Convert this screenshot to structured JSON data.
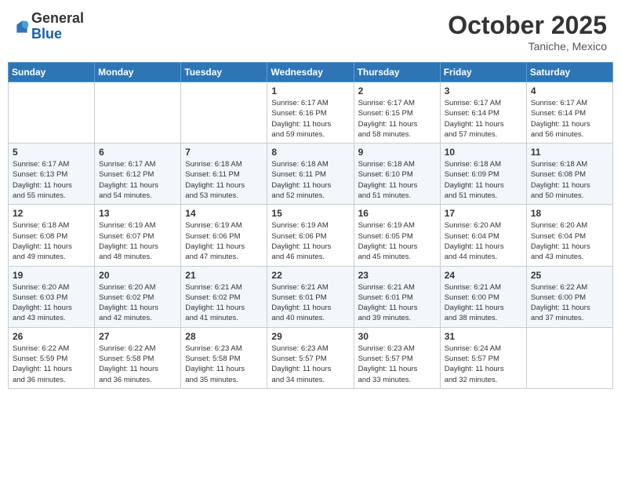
{
  "header": {
    "logo": {
      "general": "General",
      "blue": "Blue"
    },
    "title": "October 2025",
    "location": "Taniche, Mexico"
  },
  "weekdays": [
    "Sunday",
    "Monday",
    "Tuesday",
    "Wednesday",
    "Thursday",
    "Friday",
    "Saturday"
  ],
  "weeks": [
    [
      {
        "day": "",
        "info": ""
      },
      {
        "day": "",
        "info": ""
      },
      {
        "day": "",
        "info": ""
      },
      {
        "day": "1",
        "info": "Sunrise: 6:17 AM\nSunset: 6:16 PM\nDaylight: 11 hours\nand 59 minutes."
      },
      {
        "day": "2",
        "info": "Sunrise: 6:17 AM\nSunset: 6:15 PM\nDaylight: 11 hours\nand 58 minutes."
      },
      {
        "day": "3",
        "info": "Sunrise: 6:17 AM\nSunset: 6:14 PM\nDaylight: 11 hours\nand 57 minutes."
      },
      {
        "day": "4",
        "info": "Sunrise: 6:17 AM\nSunset: 6:14 PM\nDaylight: 11 hours\nand 56 minutes."
      }
    ],
    [
      {
        "day": "5",
        "info": "Sunrise: 6:17 AM\nSunset: 6:13 PM\nDaylight: 11 hours\nand 55 minutes."
      },
      {
        "day": "6",
        "info": "Sunrise: 6:17 AM\nSunset: 6:12 PM\nDaylight: 11 hours\nand 54 minutes."
      },
      {
        "day": "7",
        "info": "Sunrise: 6:18 AM\nSunset: 6:11 PM\nDaylight: 11 hours\nand 53 minutes."
      },
      {
        "day": "8",
        "info": "Sunrise: 6:18 AM\nSunset: 6:11 PM\nDaylight: 11 hours\nand 52 minutes."
      },
      {
        "day": "9",
        "info": "Sunrise: 6:18 AM\nSunset: 6:10 PM\nDaylight: 11 hours\nand 51 minutes."
      },
      {
        "day": "10",
        "info": "Sunrise: 6:18 AM\nSunset: 6:09 PM\nDaylight: 11 hours\nand 51 minutes."
      },
      {
        "day": "11",
        "info": "Sunrise: 6:18 AM\nSunset: 6:08 PM\nDaylight: 11 hours\nand 50 minutes."
      }
    ],
    [
      {
        "day": "12",
        "info": "Sunrise: 6:18 AM\nSunset: 6:08 PM\nDaylight: 11 hours\nand 49 minutes."
      },
      {
        "day": "13",
        "info": "Sunrise: 6:19 AM\nSunset: 6:07 PM\nDaylight: 11 hours\nand 48 minutes."
      },
      {
        "day": "14",
        "info": "Sunrise: 6:19 AM\nSunset: 6:06 PM\nDaylight: 11 hours\nand 47 minutes."
      },
      {
        "day": "15",
        "info": "Sunrise: 6:19 AM\nSunset: 6:06 PM\nDaylight: 11 hours\nand 46 minutes."
      },
      {
        "day": "16",
        "info": "Sunrise: 6:19 AM\nSunset: 6:05 PM\nDaylight: 11 hours\nand 45 minutes."
      },
      {
        "day": "17",
        "info": "Sunrise: 6:20 AM\nSunset: 6:04 PM\nDaylight: 11 hours\nand 44 minutes."
      },
      {
        "day": "18",
        "info": "Sunrise: 6:20 AM\nSunset: 6:04 PM\nDaylight: 11 hours\nand 43 minutes."
      }
    ],
    [
      {
        "day": "19",
        "info": "Sunrise: 6:20 AM\nSunset: 6:03 PM\nDaylight: 11 hours\nand 43 minutes."
      },
      {
        "day": "20",
        "info": "Sunrise: 6:20 AM\nSunset: 6:02 PM\nDaylight: 11 hours\nand 42 minutes."
      },
      {
        "day": "21",
        "info": "Sunrise: 6:21 AM\nSunset: 6:02 PM\nDaylight: 11 hours\nand 41 minutes."
      },
      {
        "day": "22",
        "info": "Sunrise: 6:21 AM\nSunset: 6:01 PM\nDaylight: 11 hours\nand 40 minutes."
      },
      {
        "day": "23",
        "info": "Sunrise: 6:21 AM\nSunset: 6:01 PM\nDaylight: 11 hours\nand 39 minutes."
      },
      {
        "day": "24",
        "info": "Sunrise: 6:21 AM\nSunset: 6:00 PM\nDaylight: 11 hours\nand 38 minutes."
      },
      {
        "day": "25",
        "info": "Sunrise: 6:22 AM\nSunset: 6:00 PM\nDaylight: 11 hours\nand 37 minutes."
      }
    ],
    [
      {
        "day": "26",
        "info": "Sunrise: 6:22 AM\nSunset: 5:59 PM\nDaylight: 11 hours\nand 36 minutes."
      },
      {
        "day": "27",
        "info": "Sunrise: 6:22 AM\nSunset: 5:58 PM\nDaylight: 11 hours\nand 36 minutes."
      },
      {
        "day": "28",
        "info": "Sunrise: 6:23 AM\nSunset: 5:58 PM\nDaylight: 11 hours\nand 35 minutes."
      },
      {
        "day": "29",
        "info": "Sunrise: 6:23 AM\nSunset: 5:57 PM\nDaylight: 11 hours\nand 34 minutes."
      },
      {
        "day": "30",
        "info": "Sunrise: 6:23 AM\nSunset: 5:57 PM\nDaylight: 11 hours\nand 33 minutes."
      },
      {
        "day": "31",
        "info": "Sunrise: 6:24 AM\nSunset: 5:57 PM\nDaylight: 11 hours\nand 32 minutes."
      },
      {
        "day": "",
        "info": ""
      }
    ]
  ]
}
